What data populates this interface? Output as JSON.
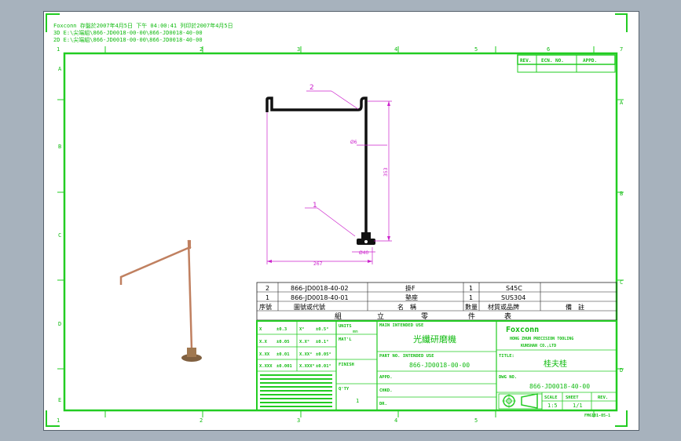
{
  "header": {
    "line1": "Foxconn  存盤於2007年4月5日 下午 04:00:41  列印於2007年4月5日",
    "line2": "3D  E:\\尖端組\\866-JD0018-00-00\\866-JD0018-40-00",
    "line3": "2D  E:\\尖端組\\866-JD0018-00-00\\866-JD0018-40-00"
  },
  "grid": {
    "cols": [
      "1",
      "2",
      "3",
      "4",
      "5",
      "6",
      "7"
    ],
    "rows": [
      "A",
      "B",
      "C",
      "D",
      "E",
      "F"
    ]
  },
  "revision_block": {
    "rev": "REV.",
    "ecn_no": "ECN. NO.",
    "appd": "APPD."
  },
  "callouts": {
    "part_2": "2",
    "part_1": "1"
  },
  "dimensions": {
    "diameter_top": "Ø6",
    "diameter_bottom": "Ø40",
    "height": "353",
    "width": "267"
  },
  "bom": {
    "rows": [
      {
        "no": "2",
        "drawing_no": "866-JD0018-40-02",
        "name": "掛F",
        "qty": "1",
        "material": "S45C",
        "remark": ""
      },
      {
        "no": "1",
        "drawing_no": "866-JD0018-40-01",
        "name": "墊座",
        "qty": "1",
        "material": "SUS304",
        "remark": ""
      }
    ],
    "header": {
      "no": "序號",
      "drawing_no": "圖號或代號",
      "name": "名　稱",
      "qty": "數量",
      "material": "材質或品牌",
      "remark": "備　註"
    },
    "group_row": {
      "a": "組",
      "b": "立",
      "c": "零",
      "d": "件",
      "e": "表"
    }
  },
  "tolerance": {
    "rows": [
      [
        "X",
        "±0.3",
        "X°",
        "±0.5°"
      ],
      [
        "X.X",
        "±0.05",
        "X.X°",
        "±0.1°"
      ],
      [
        "X.XX",
        "±0.01",
        "X.XX°",
        "±0.05°"
      ],
      [
        "X.XXX",
        "±0.001",
        "X.XXX°",
        "±0.01°"
      ]
    ],
    "units_label": "UNITS",
    "units_value": "mm",
    "matl_label": "MAT'L",
    "finish_label": "FINISH",
    "qty_label": "Q'TY",
    "qty_value": "1"
  },
  "title_block": {
    "main_system_label": "MAIN INTENDED USE",
    "main_system_value": "光纖研磨機",
    "part_no_label": "PART NO. INTENDED USE",
    "part_no_value": "866-JD0018-00-00",
    "appd_label": "APPD.",
    "chkd_label": "CHKD.",
    "dr_label": "DR.",
    "company_brand": "Foxconn",
    "company_line1": "HONG ZHUN PRECISION TOOLING",
    "company_line2": "KUNSHAN  CO.,LTD",
    "title_label": "TITLE:",
    "title_value": "桂夫桂",
    "dwg_no_label": "DWG NO.",
    "dwg_no_value": "866-JD0018-40-00",
    "scale_label": "SCALE",
    "scale_value": "1:5",
    "sheet_label": "SHEET",
    "sheet_value": "1/1",
    "rev_label": "REV.",
    "rev_value": "",
    "form_no": "FM6101-05-1"
  },
  "colors": {
    "frame": "#22cc22",
    "bom_text": "#000000",
    "dimension": "#cc22cc",
    "part_outline": "#111111",
    "preview_rod": "#c08060"
  }
}
